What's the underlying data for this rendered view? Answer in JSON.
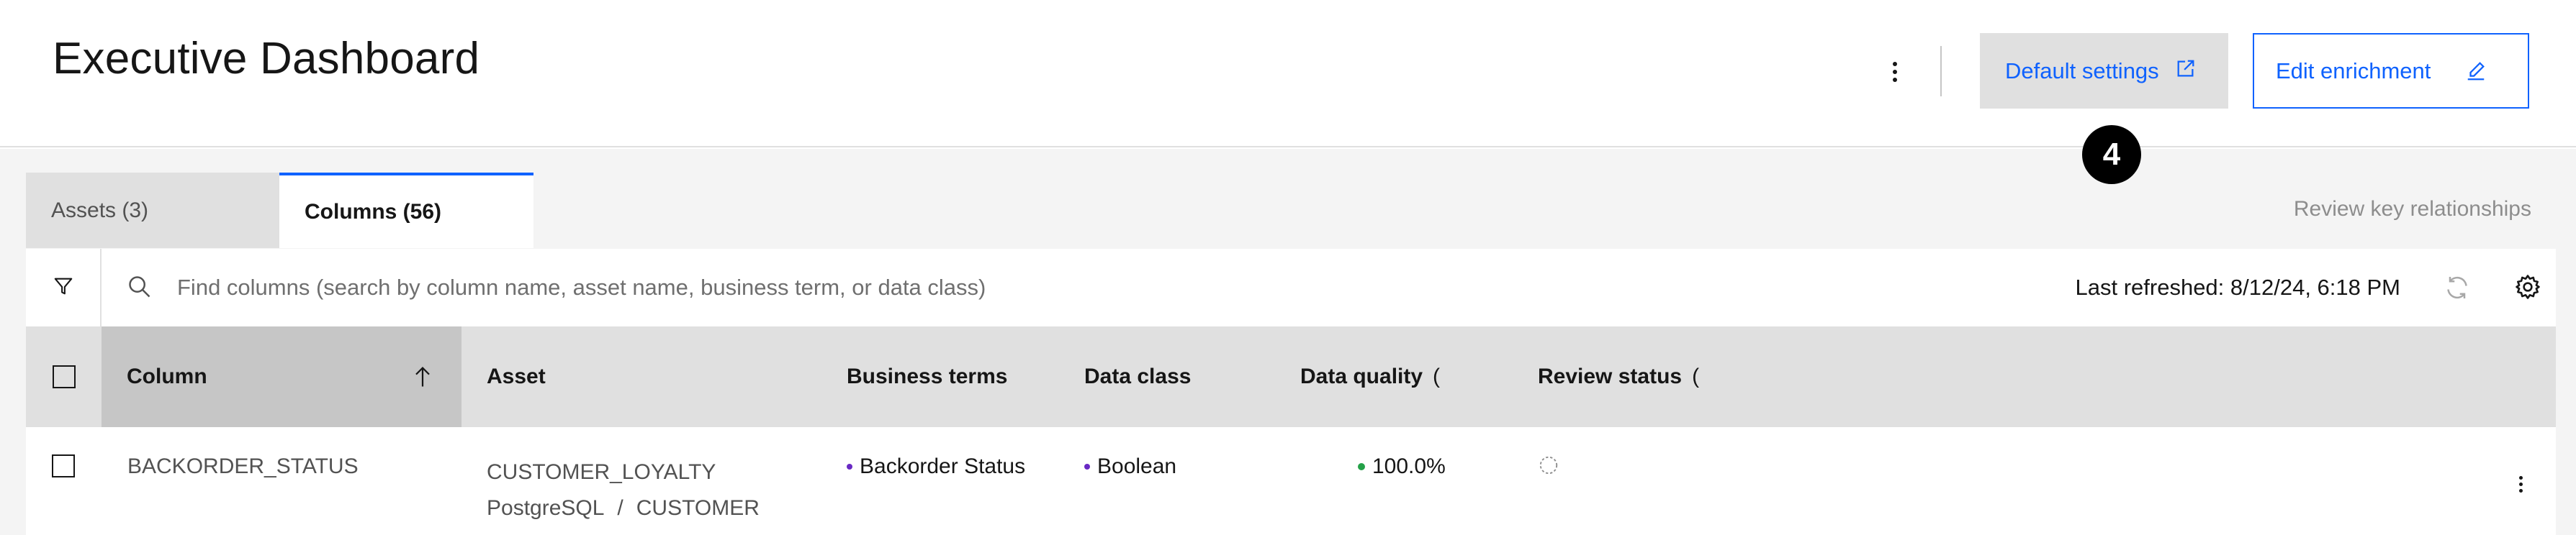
{
  "header": {
    "title": "Executive Dashboard",
    "default_settings_label": "Default settings",
    "edit_enrichment_label": "Edit enrichment",
    "callout_number": "4"
  },
  "tabs": [
    {
      "label": "Assets (3)",
      "selected": false
    },
    {
      "label": "Columns (56)",
      "selected": true
    }
  ],
  "review_key_relationships": "Review key relationships",
  "toolbar": {
    "search_placeholder": "Find columns (search by column name, asset name, business term, or data class)",
    "last_refreshed": "Last refreshed: 8/12/24, 6:18 PM"
  },
  "table": {
    "headers": {
      "column": "Column",
      "asset": "Asset",
      "business_terms": "Business terms",
      "data_class": "Data class",
      "data_quality": "Data quality",
      "review_status": "Review status",
      "paren": "("
    },
    "rows": [
      {
        "column": "BACKORDER_STATUS",
        "asset_name": "CUSTOMER_LOYALTY",
        "asset_source": "PostgreSQL",
        "asset_separator": "/",
        "asset_schema": "CUSTOMER",
        "business_term": "Backorder Status",
        "data_class": "Boolean",
        "data_quality": "100.0%"
      }
    ]
  },
  "colors": {
    "accent": "#0f62fe",
    "term_bullet": "#6929c4",
    "quality_bullet": "#24a148"
  },
  "icons": [
    "overflow-menu-icon",
    "launch-icon",
    "edit-icon",
    "filter-icon",
    "search-icon",
    "refresh-icon",
    "settings-icon",
    "sort-ascending-icon",
    "pending-status-icon"
  ]
}
